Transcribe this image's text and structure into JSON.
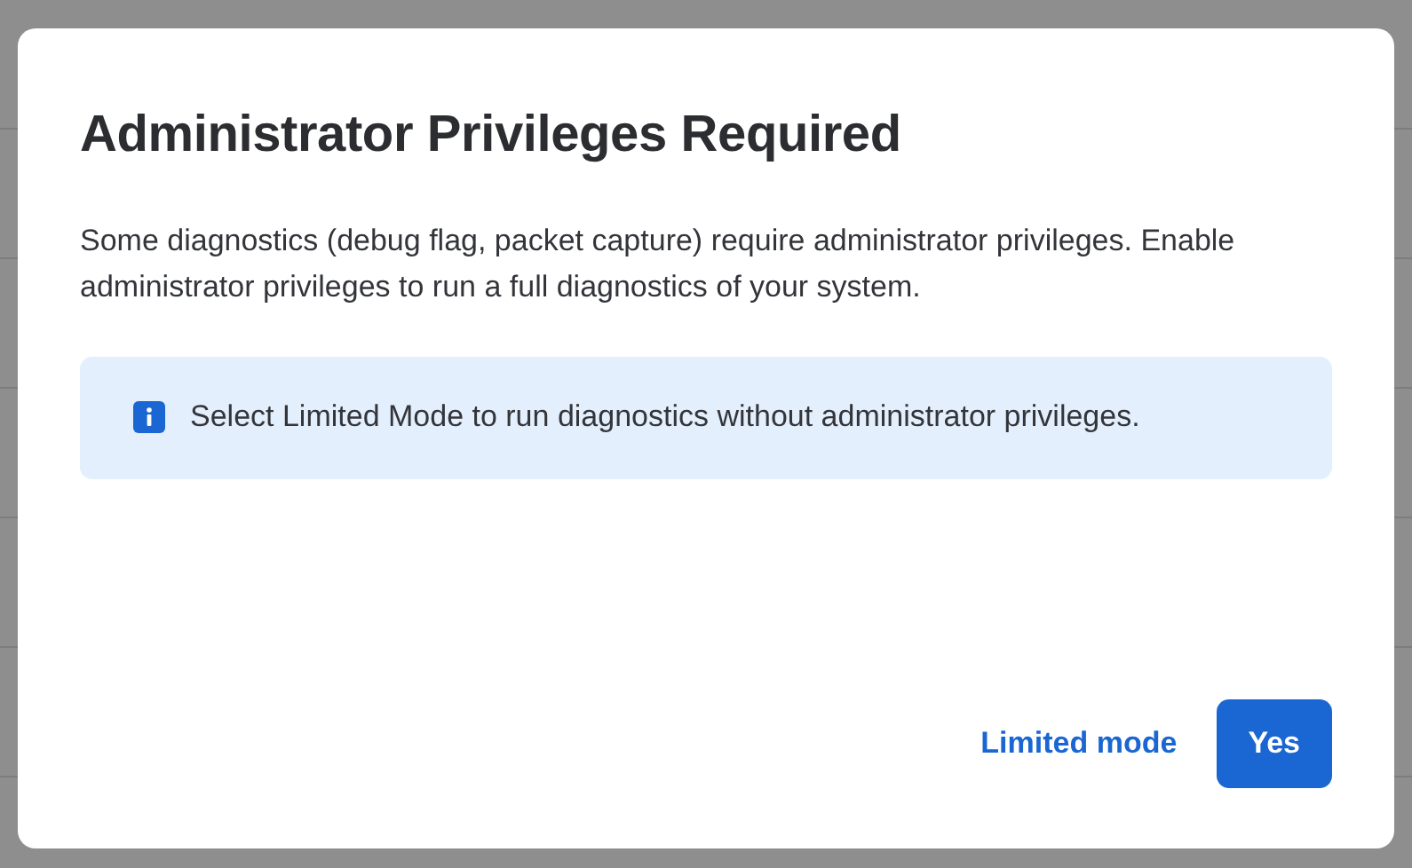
{
  "dialog": {
    "title": "Administrator Privileges Required",
    "message": "Some diagnostics (debug flag, packet capture) require administrator privileges. Enable administrator privileges to run a full diagnostics of your system.",
    "notice": {
      "kind": "info",
      "text": "Select Limited Mode to run diagnostics without administrator privileges."
    },
    "buttons": [
      {
        "label": "Limited mode",
        "kind": "link"
      },
      {
        "label": "Yes",
        "kind": "primary"
      }
    ]
  }
}
